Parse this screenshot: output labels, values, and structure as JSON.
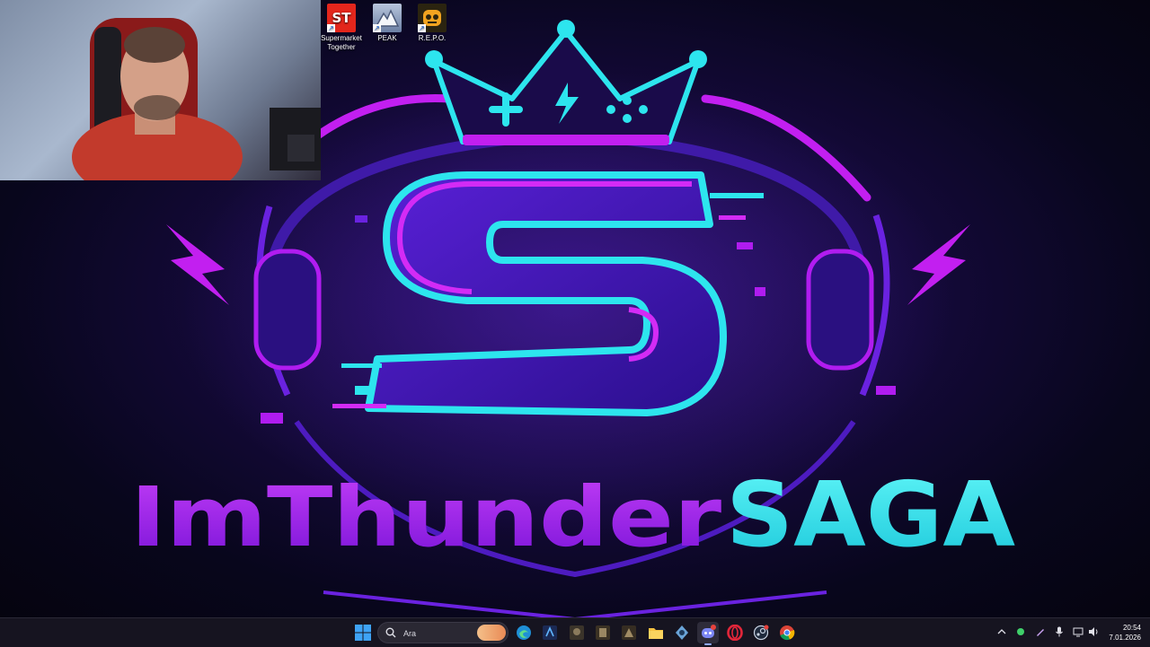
{
  "wallpaper": {
    "logo_letter": "S",
    "name_part1": "ImThunder",
    "name_part2": "SAGA",
    "colors": {
      "purple": "#b01cf0",
      "cyan": "#28e6ee",
      "deep_violet": "#3a17a8"
    }
  },
  "desktop_icons": [
    {
      "label": "Supermarket Together",
      "line1": "Supermarket",
      "line2": "Together",
      "icon": "supermarket-together-app-icon",
      "tile_text": "ST",
      "color": "#e3261c"
    },
    {
      "label": "PEAK",
      "line1": "PEAK",
      "line2": "",
      "icon": "peak-app-icon",
      "color": "#8a9fc2"
    },
    {
      "label": "R.E.P.O.",
      "line1": "R.E.P.O.",
      "line2": "",
      "icon": "repo-app-icon",
      "color": "#f2a320"
    }
  ],
  "taskbar": {
    "search_placeholder": "Ara",
    "pinned_apps": [
      "search-highlight-icon",
      "edge-icon",
      "game-launcher-icon",
      "game-app-icon-1",
      "game-app-icon-2",
      "game-app-icon-3",
      "file-explorer-icon",
      "settings-app-icon",
      "discord-icon",
      "opera-icon",
      "steam-icon",
      "chrome-icon"
    ],
    "clock_time": "20:54",
    "clock_date": "7.01.2026"
  }
}
